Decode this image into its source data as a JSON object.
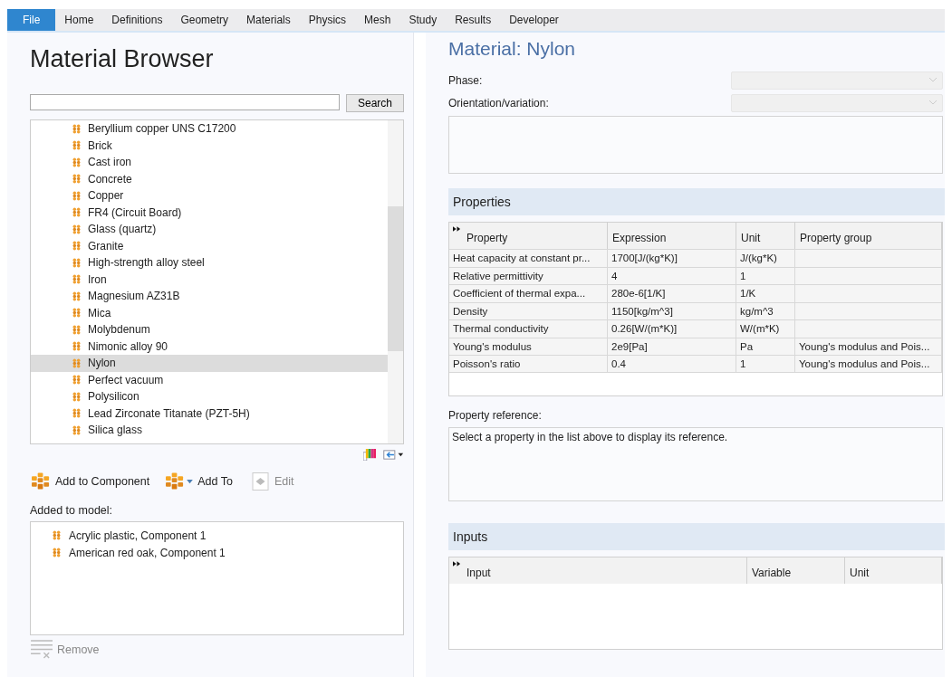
{
  "ribbon_tabs": [
    {
      "label": "File",
      "selected": true
    },
    {
      "label": "Home",
      "selected": false
    },
    {
      "label": "Definitions",
      "selected": false
    },
    {
      "label": "Geometry",
      "selected": false
    },
    {
      "label": "Materials",
      "selected": false
    },
    {
      "label": "Physics",
      "selected": false
    },
    {
      "label": "Mesh",
      "selected": false
    },
    {
      "label": "Study",
      "selected": false
    },
    {
      "label": "Results",
      "selected": false
    },
    {
      "label": "Developer",
      "selected": false
    }
  ],
  "browser": {
    "title": "Material Browser",
    "search_button": "Search",
    "materials": [
      {
        "name": "Beryllium copper UNS C17200",
        "selected": false
      },
      {
        "name": "Brick",
        "selected": false
      },
      {
        "name": "Cast iron",
        "selected": false
      },
      {
        "name": "Concrete",
        "selected": false
      },
      {
        "name": "Copper",
        "selected": false
      },
      {
        "name": "FR4 (Circuit Board)",
        "selected": false
      },
      {
        "name": "Glass (quartz)",
        "selected": false
      },
      {
        "name": "Granite",
        "selected": false
      },
      {
        "name": "High-strength alloy steel",
        "selected": false
      },
      {
        "name": "Iron",
        "selected": false
      },
      {
        "name": "Magnesium AZ31B",
        "selected": false
      },
      {
        "name": "Mica",
        "selected": false
      },
      {
        "name": "Molybdenum",
        "selected": false
      },
      {
        "name": "Nimonic alloy 90",
        "selected": false
      },
      {
        "name": "Nylon",
        "selected": true
      },
      {
        "name": "Perfect vacuum",
        "selected": false
      },
      {
        "name": "Polysilicon",
        "selected": false
      },
      {
        "name": "Lead Zirconate Titanate (PZT-5H)",
        "selected": false
      },
      {
        "name": "Silica glass",
        "selected": false
      }
    ],
    "actions": [
      {
        "label": "Add to Component",
        "kind": "add",
        "disabled": false
      },
      {
        "label": "Add To",
        "kind": "add-menu",
        "disabled": false
      },
      {
        "label": "Edit",
        "kind": "edit",
        "disabled": true
      }
    ],
    "added_label": "Added to model:",
    "added": [
      "Acrylic plastic, Component 1",
      "American red oak, Component 1"
    ],
    "remove_button": "Remove"
  },
  "material": {
    "title": "Material: Nylon",
    "phase_label": "Phase:",
    "orientation_label": "Orientation/variation:",
    "properties_heading": "Properties",
    "properties_columns": [
      "Property",
      "Expression",
      "Unit",
      "Property group"
    ],
    "properties_rows": [
      [
        "Heat capacity at constant pr...",
        "1700[J/(kg*K)]",
        "J/(kg*K)",
        ""
      ],
      [
        "Relative permittivity",
        "4",
        "1",
        ""
      ],
      [
        "Coefficient of thermal expa...",
        "280e-6[1/K]",
        "1/K",
        ""
      ],
      [
        "Density",
        "1150[kg/m^3]",
        "kg/m^3",
        ""
      ],
      [
        "Thermal conductivity",
        "0.26[W/(m*K)]",
        "W/(m*K)",
        ""
      ],
      [
        "Young's modulus",
        "2e9[Pa]",
        "Pa",
        "Young's modulus and Pois..."
      ],
      [
        "Poisson's ratio",
        "0.4",
        "1",
        "Young's modulus and Pois..."
      ]
    ],
    "reference_label": "Property reference:",
    "reference_text": "Select a property in the list above to display its reference.",
    "inputs_heading": "Inputs",
    "inputs_columns": [
      "Input",
      "Variable",
      "Unit"
    ]
  }
}
